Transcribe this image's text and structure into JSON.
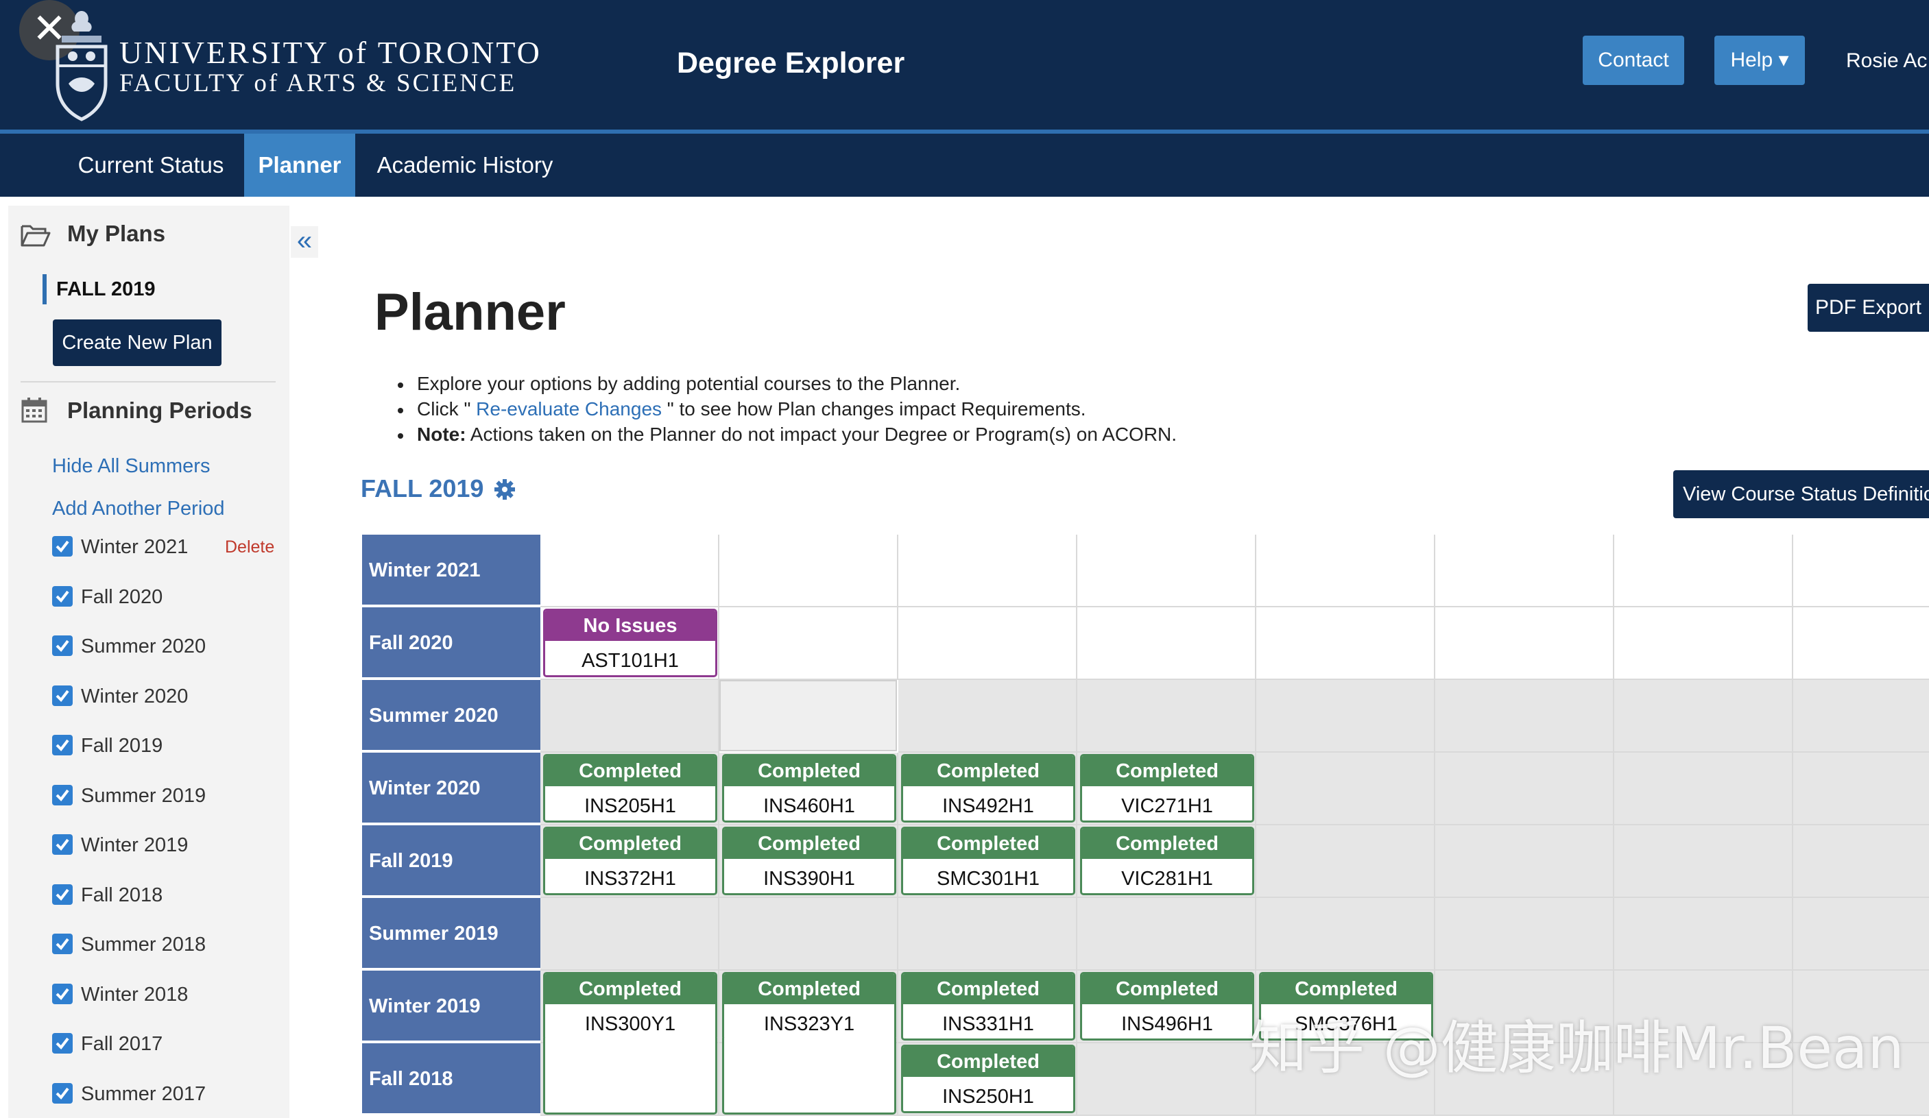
{
  "header": {
    "close_glyph": "✕",
    "university": "UNIVERSITY of TORONTO",
    "faculty": "FACULTY of ARTS & SCIENCE",
    "app_title": "Degree Explorer",
    "contact_label": "Contact",
    "help_label": "Help ▾",
    "user_name": "Rosie Ac"
  },
  "nav": {
    "tabs": [
      {
        "label": "Current Status"
      },
      {
        "label": "Planner",
        "active": true
      },
      {
        "label": "Academic History"
      }
    ]
  },
  "sidebar": {
    "my_plans_title": "My Plans",
    "current_plan": "FALL 2019",
    "create_plan_label": "Create New Plan",
    "planning_periods_title": "Planning Periods",
    "hide_summers_label": "Hide All Summers",
    "add_period_label": "Add Another Period",
    "delete_label": "Delete",
    "periods": [
      {
        "label": "Winter 2021",
        "checked": true
      },
      {
        "label": "Fall 2020",
        "checked": true
      },
      {
        "label": "Summer 2020",
        "checked": true
      },
      {
        "label": "Winter 2020",
        "checked": true
      },
      {
        "label": "Fall 2019",
        "checked": true
      },
      {
        "label": "Summer 2019",
        "checked": true
      },
      {
        "label": "Winter 2019",
        "checked": true
      },
      {
        "label": "Fall 2018",
        "checked": true
      },
      {
        "label": "Summer 2018",
        "checked": true
      },
      {
        "label": "Winter 2018",
        "checked": true
      },
      {
        "label": "Fall 2017",
        "checked": true
      },
      {
        "label": "Summer 2017",
        "checked": true
      }
    ],
    "collapse_glyph": "«"
  },
  "main": {
    "title": "Planner",
    "pdf_export_label": "PDF Export",
    "bullets": {
      "b1": "Explore your options by adding potential courses to the Planner.",
      "b2_prefix": "Click \" ",
      "b2_link": "Re-evaluate Changes",
      "b2_suffix": " \" to see how Plan changes impact Requirements.",
      "b3_strong": "Note:",
      "b3_text": " Actions taken on the Planner do not impact your Degree or Program(s) on ACORN."
    },
    "plan_header": "FALL 2019",
    "status_def_label": "View Course Status Definitio"
  },
  "planner": {
    "rows": [
      {
        "label": "Winter 2021",
        "shade": "white",
        "courses": []
      },
      {
        "label": "Fall 2020",
        "shade": "white",
        "courses": [
          {
            "status": "No Issues",
            "code": "AST101H1"
          }
        ]
      },
      {
        "label": "Summer 2020",
        "shade": "grey",
        "courses": []
      },
      {
        "label": "Winter 2020",
        "shade": "grey",
        "courses": [
          {
            "status": "Completed",
            "code": "INS205H1"
          },
          {
            "status": "Completed",
            "code": "INS460H1"
          },
          {
            "status": "Completed",
            "code": "INS492H1"
          },
          {
            "status": "Completed",
            "code": "VIC271H1"
          }
        ]
      },
      {
        "label": "Fall 2019",
        "shade": "grey",
        "courses": [
          {
            "status": "Completed",
            "code": "INS372H1"
          },
          {
            "status": "Completed",
            "code": "INS390H1"
          },
          {
            "status": "Completed",
            "code": "SMC301H1"
          },
          {
            "status": "Completed",
            "code": "VIC281H1"
          }
        ]
      },
      {
        "label": "Summer 2019",
        "shade": "grey",
        "courses": []
      },
      {
        "label": "Winter 2019",
        "shade": "grey",
        "courses": [
          {
            "status": "Completed",
            "code": "INS300Y1"
          },
          {
            "status": "Completed",
            "code": "INS323Y1"
          },
          {
            "status": "Completed",
            "code": "INS331H1"
          },
          {
            "status": "Completed",
            "code": "INS496H1"
          },
          {
            "status": "Completed",
            "code": "SMC376H1"
          }
        ]
      },
      {
        "label": "Fall 2018",
        "shade": "grey",
        "courses": [
          {
            "status": "",
            "code": ""
          },
          {
            "status": "",
            "code": ""
          },
          {
            "status": "Completed",
            "code": "INS250H1"
          }
        ]
      }
    ]
  },
  "watermark": "知乎 @健康咖啡Mr.Bean",
  "colors": {
    "header_bg": "#0f2a4e",
    "accent_blue": "#3b83c3",
    "row_label_bg": "#4f6fa8",
    "completed_green": "#4b8a58",
    "no_issues_purple": "#8e3a8f",
    "link_blue": "#2d6fb6"
  }
}
